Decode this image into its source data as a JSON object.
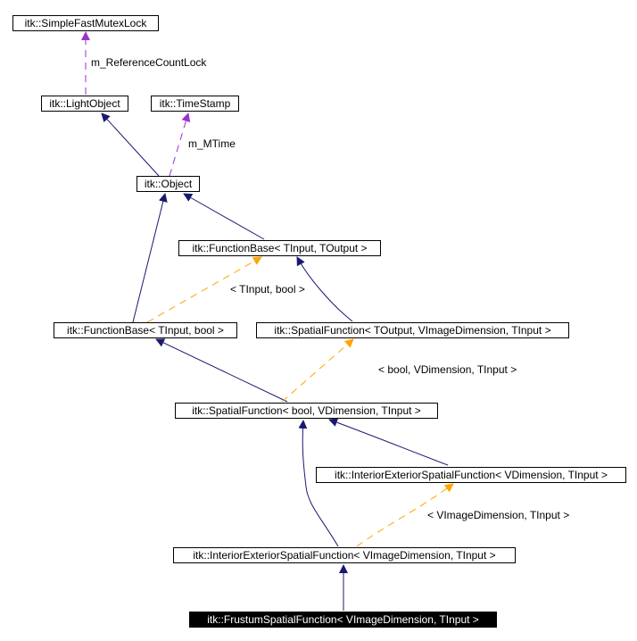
{
  "colors": {
    "inheritance": "#191970",
    "template": "#ffa500",
    "usage": "#9a32cd"
  },
  "nodes": {
    "mutex": "itk::SimpleFastMutexLock",
    "lightobject": "itk::LightObject",
    "timestamp": "itk::TimeStamp",
    "object": "itk::Object",
    "fb_tout": "itk::FunctionBase< TInput, TOutput >",
    "fb_bool": "itk::FunctionBase< TInput, bool >",
    "sf_tout": "itk::SpatialFunction< TOutput, VImageDimension, TInput >",
    "sf_bool": "itk::SpatialFunction< bool, VDimension, TInput >",
    "iesf_vdim": "itk::InteriorExteriorSpatialFunction< VDimension, TInput >",
    "iesf_vimg": "itk::InteriorExteriorSpatialFunction< VImageDimension, TInput >",
    "frustum": "itk::FrustumSpatialFunction< VImageDimension, TInput >"
  },
  "edge_labels": {
    "refcount": "m_ReferenceCountLock",
    "mtime": "m_MTime",
    "tinput_bool": "< TInput, bool >",
    "bool_vdim": "< bool, VDimension, TInput >",
    "vimg_tinput": "< VImageDimension, TInput >"
  }
}
